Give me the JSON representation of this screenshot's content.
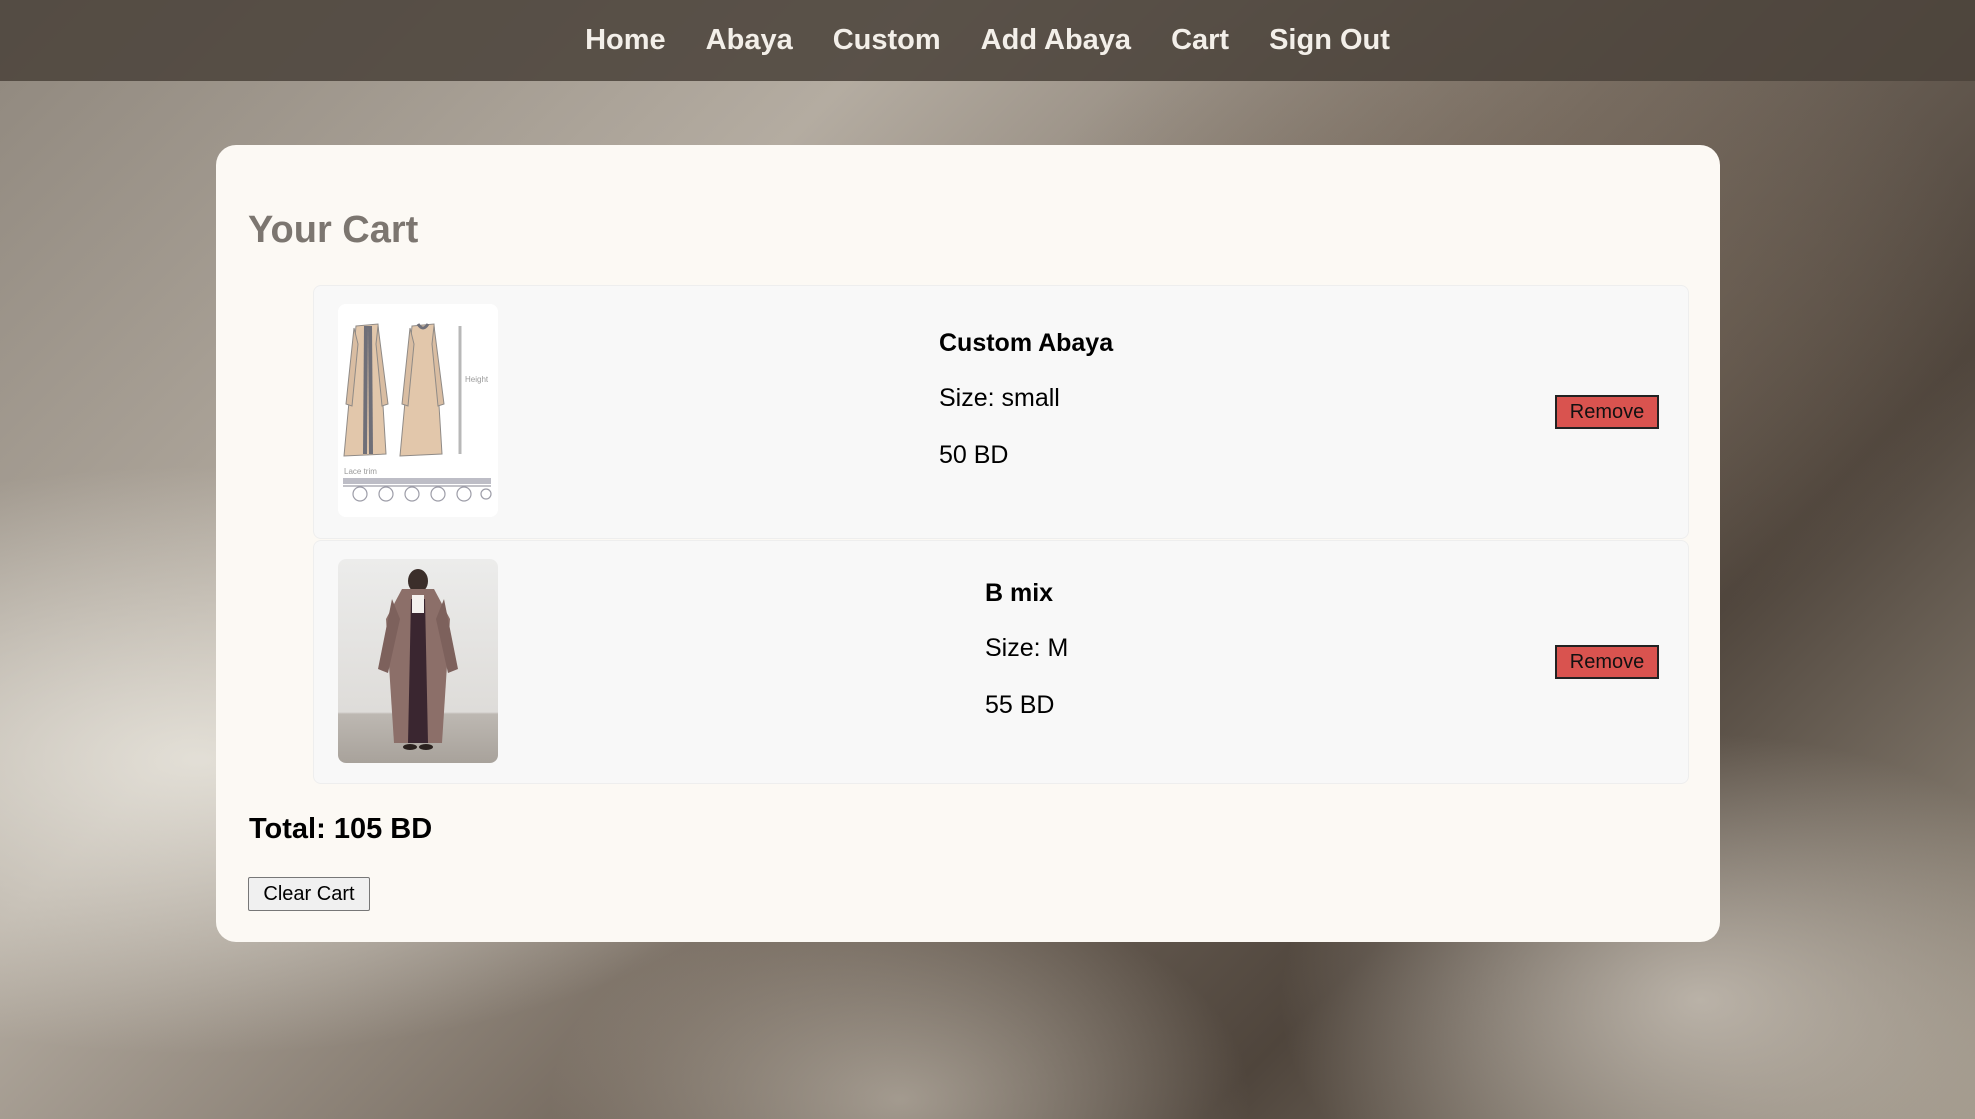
{
  "nav": {
    "items": [
      {
        "label": "Home"
      },
      {
        "label": "Abaya"
      },
      {
        "label": "Custom"
      },
      {
        "label": "Add Abaya"
      },
      {
        "label": "Cart"
      },
      {
        "label": "Sign Out"
      }
    ]
  },
  "cart": {
    "title": "Your Cart",
    "items": [
      {
        "name": "Custom Abaya",
        "size": "Size: small",
        "price": "50 BD",
        "remove_label": "Remove",
        "image": {
          "label_height": "Height",
          "label_trim": "Lace trim"
        }
      },
      {
        "name": "B mix",
        "size": "Size: M",
        "price": "55 BD",
        "remove_label": "Remove"
      }
    ],
    "total": "Total: 105 BD",
    "clear_label": "Clear Cart"
  },
  "colors": {
    "nav_bg": "#4b423a",
    "card_bg": "#fcf9f4",
    "remove_button": "#d9534f",
    "title_text": "#7c7670"
  }
}
